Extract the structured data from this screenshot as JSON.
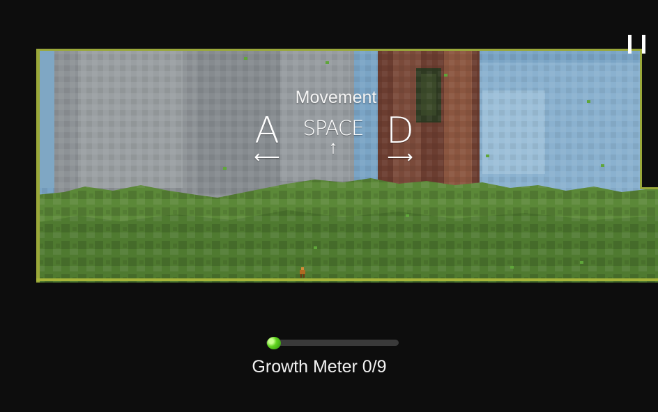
{
  "hud": {
    "pause_icon": "pause-icon",
    "movement_title": "Movement",
    "growth_meter": {
      "label": "Growth Meter 0/9",
      "current": 0,
      "max": 9,
      "fill_color": "#56c21c"
    }
  },
  "controls": [
    {
      "key": "A",
      "arrow": "⟵",
      "direction": "left"
    },
    {
      "key": "SPACE",
      "arrow": "↑",
      "direction": "up"
    },
    {
      "key": "D",
      "arrow": "⟶",
      "direction": "right"
    }
  ],
  "colors": {
    "background": "#0d0d0d",
    "grass_edge": "#a6b43a",
    "rock": "#8f9497",
    "sky": "#7aa4c5",
    "bush": "#5b8838",
    "trunk": "#6d3f31"
  }
}
